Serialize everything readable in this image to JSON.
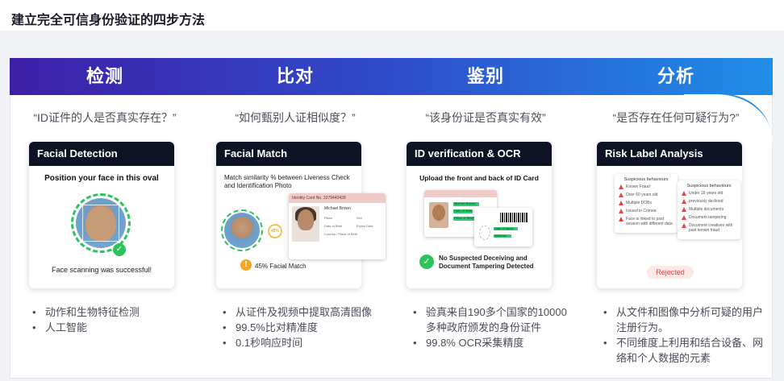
{
  "page": {
    "title": "建立完全可信身份验证的四步方法"
  },
  "columns": [
    {
      "title": "检测",
      "question": "“ID证件的人是否真实存在？”",
      "card": {
        "header": "Facial Detection",
        "instruction": "Position your face in this oval",
        "status": "Face scanning was successful!"
      },
      "bullets": [
        "动作和生物特征检测",
        "人工智能"
      ]
    },
    {
      "title": "比对",
      "question": "“如何甄别人证相似度？”",
      "card": {
        "header": "Facial Match",
        "description": "Match similarity % between Liveness Check and Identification Photo",
        "id_card_label": "Identity Card No. 3379440428",
        "id_name": "Michael Brown",
        "id_fields": [
          "Place",
          "Sex",
          "Date of Birth",
          "Expiry Date",
          "Country / Place of Birth"
        ],
        "match_percent_label": "48%",
        "match_text": "45% Facial Match"
      },
      "bullets": [
        "从证件及视频中提取高清图像",
        "99.5%比对精准度",
        "0.1秒响应时间"
      ]
    },
    {
      "title": "鉴别",
      "question": "“该身份证是否真实有效”",
      "card": {
        "header": "ID verification & OCR",
        "instruction": "Upload the front and back of ID Card",
        "front_fields": [
          "Michael Brown",
          "Date of Birth",
          "Place of Birth"
        ],
        "back_fields": [
          "Date of Issue",
          "Address"
        ],
        "result": "No Suspected Deceiving and Document Tampering Detected"
      },
      "bullets": [
        "验真来自190多个国家的10000多种政府颁发的身份证件",
        "99.8% OCR采集精度"
      ]
    },
    {
      "title": "分析",
      "question": "“是否存在任何可疑行为?”",
      "card": {
        "header": "Risk Label Analysis",
        "list_left_title": "Suspicious behaviours",
        "list_left": [
          "Known Fraud",
          "Over 60 years old",
          "Multiple DOBs",
          "Issued in Crimea",
          "Face is linked to past session with different data"
        ],
        "list_right_title": "Suspicious behaviours",
        "list_right": [
          "Under 16 years old",
          "previously declined",
          "Multiple documents",
          "Document tampering",
          "Document creatives with past known fraud"
        ],
        "status": "Rejected"
      },
      "bullets": [
        "从文件和图像中分析可疑的用户注册行为。",
        "不同维度上利用和结合设备、网络和个人数据的元素"
      ]
    }
  ],
  "colors": {
    "header_start": "#3d1fa6",
    "header_mid": "#2f4ccc",
    "header_end": "#1f8ee6",
    "card_header": "#0d1224",
    "success": "#2cc35a",
    "warning": "#f5a623",
    "danger": "#e04848"
  }
}
